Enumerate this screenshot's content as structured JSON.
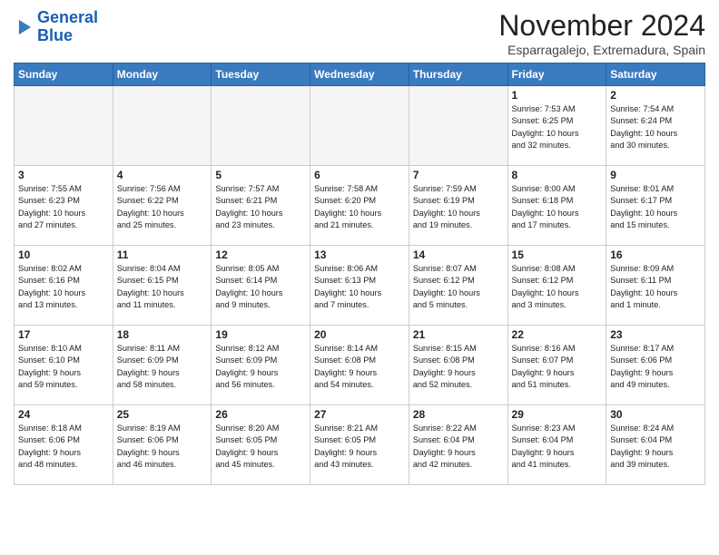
{
  "logo": {
    "line1": "General",
    "line2": "Blue"
  },
  "title": "November 2024",
  "location": "Esparragalejo, Extremadura, Spain",
  "days_of_week": [
    "Sunday",
    "Monday",
    "Tuesday",
    "Wednesday",
    "Thursday",
    "Friday",
    "Saturday"
  ],
  "weeks": [
    [
      {
        "num": "",
        "info": "",
        "empty": true
      },
      {
        "num": "",
        "info": "",
        "empty": true
      },
      {
        "num": "",
        "info": "",
        "empty": true
      },
      {
        "num": "",
        "info": "",
        "empty": true
      },
      {
        "num": "",
        "info": "",
        "empty": true
      },
      {
        "num": "1",
        "info": "Sunrise: 7:53 AM\nSunset: 6:25 PM\nDaylight: 10 hours\nand 32 minutes."
      },
      {
        "num": "2",
        "info": "Sunrise: 7:54 AM\nSunset: 6:24 PM\nDaylight: 10 hours\nand 30 minutes."
      }
    ],
    [
      {
        "num": "3",
        "info": "Sunrise: 7:55 AM\nSunset: 6:23 PM\nDaylight: 10 hours\nand 27 minutes."
      },
      {
        "num": "4",
        "info": "Sunrise: 7:56 AM\nSunset: 6:22 PM\nDaylight: 10 hours\nand 25 minutes."
      },
      {
        "num": "5",
        "info": "Sunrise: 7:57 AM\nSunset: 6:21 PM\nDaylight: 10 hours\nand 23 minutes."
      },
      {
        "num": "6",
        "info": "Sunrise: 7:58 AM\nSunset: 6:20 PM\nDaylight: 10 hours\nand 21 minutes."
      },
      {
        "num": "7",
        "info": "Sunrise: 7:59 AM\nSunset: 6:19 PM\nDaylight: 10 hours\nand 19 minutes."
      },
      {
        "num": "8",
        "info": "Sunrise: 8:00 AM\nSunset: 6:18 PM\nDaylight: 10 hours\nand 17 minutes."
      },
      {
        "num": "9",
        "info": "Sunrise: 8:01 AM\nSunset: 6:17 PM\nDaylight: 10 hours\nand 15 minutes."
      }
    ],
    [
      {
        "num": "10",
        "info": "Sunrise: 8:02 AM\nSunset: 6:16 PM\nDaylight: 10 hours\nand 13 minutes."
      },
      {
        "num": "11",
        "info": "Sunrise: 8:04 AM\nSunset: 6:15 PM\nDaylight: 10 hours\nand 11 minutes."
      },
      {
        "num": "12",
        "info": "Sunrise: 8:05 AM\nSunset: 6:14 PM\nDaylight: 10 hours\nand 9 minutes."
      },
      {
        "num": "13",
        "info": "Sunrise: 8:06 AM\nSunset: 6:13 PM\nDaylight: 10 hours\nand 7 minutes."
      },
      {
        "num": "14",
        "info": "Sunrise: 8:07 AM\nSunset: 6:12 PM\nDaylight: 10 hours\nand 5 minutes."
      },
      {
        "num": "15",
        "info": "Sunrise: 8:08 AM\nSunset: 6:12 PM\nDaylight: 10 hours\nand 3 minutes."
      },
      {
        "num": "16",
        "info": "Sunrise: 8:09 AM\nSunset: 6:11 PM\nDaylight: 10 hours\nand 1 minute."
      }
    ],
    [
      {
        "num": "17",
        "info": "Sunrise: 8:10 AM\nSunset: 6:10 PM\nDaylight: 9 hours\nand 59 minutes."
      },
      {
        "num": "18",
        "info": "Sunrise: 8:11 AM\nSunset: 6:09 PM\nDaylight: 9 hours\nand 58 minutes."
      },
      {
        "num": "19",
        "info": "Sunrise: 8:12 AM\nSunset: 6:09 PM\nDaylight: 9 hours\nand 56 minutes."
      },
      {
        "num": "20",
        "info": "Sunrise: 8:14 AM\nSunset: 6:08 PM\nDaylight: 9 hours\nand 54 minutes."
      },
      {
        "num": "21",
        "info": "Sunrise: 8:15 AM\nSunset: 6:08 PM\nDaylight: 9 hours\nand 52 minutes."
      },
      {
        "num": "22",
        "info": "Sunrise: 8:16 AM\nSunset: 6:07 PM\nDaylight: 9 hours\nand 51 minutes."
      },
      {
        "num": "23",
        "info": "Sunrise: 8:17 AM\nSunset: 6:06 PM\nDaylight: 9 hours\nand 49 minutes."
      }
    ],
    [
      {
        "num": "24",
        "info": "Sunrise: 8:18 AM\nSunset: 6:06 PM\nDaylight: 9 hours\nand 48 minutes."
      },
      {
        "num": "25",
        "info": "Sunrise: 8:19 AM\nSunset: 6:06 PM\nDaylight: 9 hours\nand 46 minutes."
      },
      {
        "num": "26",
        "info": "Sunrise: 8:20 AM\nSunset: 6:05 PM\nDaylight: 9 hours\nand 45 minutes."
      },
      {
        "num": "27",
        "info": "Sunrise: 8:21 AM\nSunset: 6:05 PM\nDaylight: 9 hours\nand 43 minutes."
      },
      {
        "num": "28",
        "info": "Sunrise: 8:22 AM\nSunset: 6:04 PM\nDaylight: 9 hours\nand 42 minutes."
      },
      {
        "num": "29",
        "info": "Sunrise: 8:23 AM\nSunset: 6:04 PM\nDaylight: 9 hours\nand 41 minutes."
      },
      {
        "num": "30",
        "info": "Sunrise: 8:24 AM\nSunset: 6:04 PM\nDaylight: 9 hours\nand 39 minutes."
      }
    ]
  ]
}
